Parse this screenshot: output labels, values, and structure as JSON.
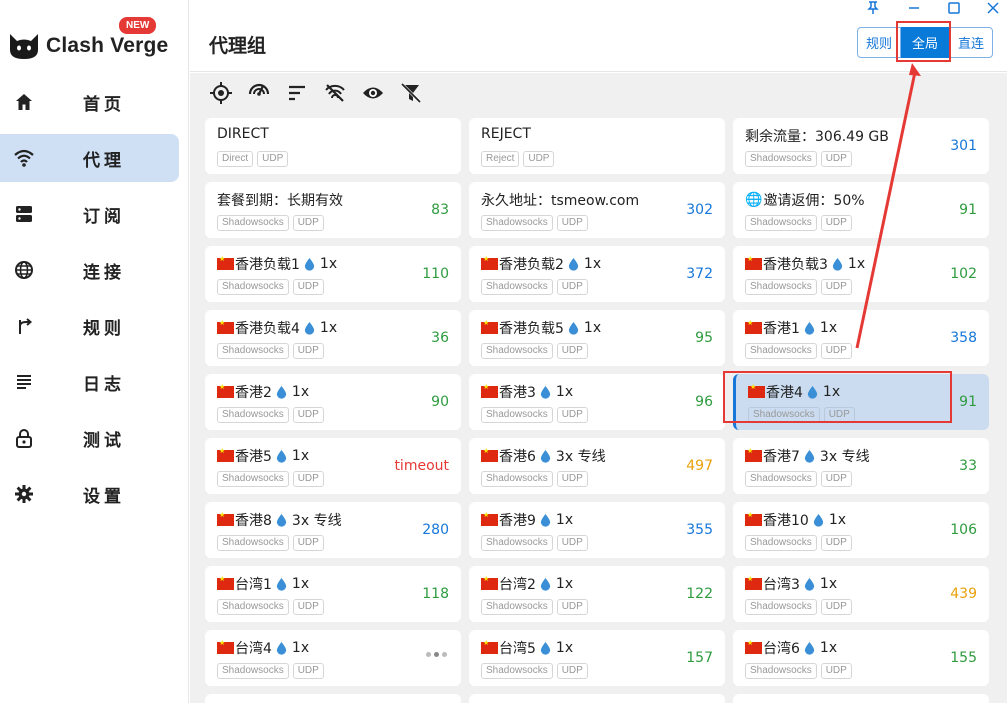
{
  "app": {
    "name": "Clash Verge",
    "badge": "NEW"
  },
  "sidebar": {
    "items": [
      {
        "label": "首页",
        "icon": "home-icon"
      },
      {
        "label": "代理",
        "icon": "wifi-icon",
        "active": true
      },
      {
        "label": "订阅",
        "icon": "server-icon"
      },
      {
        "label": "连接",
        "icon": "globe-icon"
      },
      {
        "label": "规则",
        "icon": "fork-arrow-icon"
      },
      {
        "label": "日志",
        "icon": "list-icon"
      },
      {
        "label": "测试",
        "icon": "lock-icon"
      },
      {
        "label": "设置",
        "icon": "gear-icon"
      }
    ]
  },
  "header": {
    "title": "代理组",
    "modes": [
      {
        "label": "规则",
        "active": false
      },
      {
        "label": "全局",
        "active": true
      },
      {
        "label": "直连",
        "active": false
      }
    ]
  },
  "toolbar": {
    "icons": [
      "locate-icon",
      "speed-test-icon",
      "sort-icon",
      "filter-off-icon",
      "eye-icon",
      "filter-clear-icon"
    ]
  },
  "colors": {
    "accent": "#1677d9",
    "active_nav": "#cfe0f5",
    "selected_card": "#cbdcf0",
    "annotation_red": "#e53935",
    "delay_green": "#2e9b3f",
    "delay_orange": "#e8a10c",
    "delay_blue": "#1677d9"
  },
  "proxies": [
    {
      "name": "DIRECT",
      "tags": [
        "Direct",
        "UDP"
      ],
      "delay": "",
      "color": ""
    },
    {
      "name": "REJECT",
      "tags": [
        "Reject",
        "UDP"
      ],
      "delay": "",
      "color": ""
    },
    {
      "name": "剩余流量：306.49 GB",
      "tags": [
        "Shadowsocks",
        "UDP"
      ],
      "delay": "301",
      "color": "blue"
    },
    {
      "name": "套餐到期：长期有效",
      "tags": [
        "Shadowsocks",
        "UDP"
      ],
      "delay": "83",
      "color": "green"
    },
    {
      "name": "永久地址：tsmeow.com",
      "tags": [
        "Shadowsocks",
        "UDP"
      ],
      "delay": "302",
      "color": "blue"
    },
    {
      "name": "邀请返佣：50%",
      "globe": true,
      "tags": [
        "Shadowsocks",
        "UDP"
      ],
      "delay": "91",
      "color": "green"
    },
    {
      "name": "香港负载1",
      "flag": true,
      "mult": "1x",
      "tags": [
        "Shadowsocks",
        "UDP"
      ],
      "delay": "110",
      "color": "green"
    },
    {
      "name": "香港负载2",
      "flag": true,
      "mult": "1x",
      "tags": [
        "Shadowsocks",
        "UDP"
      ],
      "delay": "372",
      "color": "blue"
    },
    {
      "name": "香港负载3",
      "flag": true,
      "mult": "1x",
      "tags": [
        "Shadowsocks",
        "UDP"
      ],
      "delay": "102",
      "color": "green"
    },
    {
      "name": "香港负载4",
      "flag": true,
      "mult": "1x",
      "tags": [
        "Shadowsocks",
        "UDP"
      ],
      "delay": "36",
      "color": "green"
    },
    {
      "name": "香港负载5",
      "flag": true,
      "mult": "1x",
      "tags": [
        "Shadowsocks",
        "UDP"
      ],
      "delay": "95",
      "color": "green"
    },
    {
      "name": "香港1",
      "flag": true,
      "mult": "1x",
      "tags": [
        "Shadowsocks",
        "UDP"
      ],
      "delay": "358",
      "color": "blue"
    },
    {
      "name": "香港2",
      "flag": true,
      "mult": "1x",
      "tags": [
        "Shadowsocks",
        "UDP"
      ],
      "delay": "90",
      "color": "green"
    },
    {
      "name": "香港3",
      "flag": true,
      "mult": "1x",
      "tags": [
        "Shadowsocks",
        "UDP"
      ],
      "delay": "96",
      "color": "green"
    },
    {
      "name": "香港4",
      "flag": true,
      "mult": "1x",
      "tags": [
        "Shadowsocks",
        "UDP"
      ],
      "delay": "91",
      "color": "green",
      "selected": true
    },
    {
      "name": "香港5",
      "flag": true,
      "mult": "1x",
      "tags": [
        "Shadowsocks",
        "UDP"
      ],
      "delay": "timeout",
      "color": "red"
    },
    {
      "name": "香港6",
      "flag": true,
      "mult": "3x 专线",
      "tags": [
        "Shadowsocks",
        "UDP"
      ],
      "delay": "497",
      "color": "orange"
    },
    {
      "name": "香港7",
      "flag": true,
      "mult": "3x 专线",
      "tags": [
        "Shadowsocks",
        "UDP"
      ],
      "delay": "33",
      "color": "green"
    },
    {
      "name": "香港8",
      "flag": true,
      "mult": "3x 专线",
      "tags": [
        "Shadowsocks",
        "UDP"
      ],
      "delay": "280",
      "color": "blue"
    },
    {
      "name": "香港9",
      "flag": true,
      "mult": "1x",
      "tags": [
        "Shadowsocks",
        "UDP"
      ],
      "delay": "355",
      "color": "blue"
    },
    {
      "name": "香港10",
      "flag": true,
      "mult": "1x",
      "tags": [
        "Shadowsocks",
        "UDP"
      ],
      "delay": "106",
      "color": "green"
    },
    {
      "name": "台湾1",
      "flag": true,
      "mult": "1x",
      "tags": [
        "Shadowsocks",
        "UDP"
      ],
      "delay": "118",
      "color": "green"
    },
    {
      "name": "台湾2",
      "flag": true,
      "mult": "1x",
      "tags": [
        "Shadowsocks",
        "UDP"
      ],
      "delay": "122",
      "color": "green"
    },
    {
      "name": "台湾3",
      "flag": true,
      "mult": "1x",
      "tags": [
        "Shadowsocks",
        "UDP"
      ],
      "delay": "439",
      "color": "orange"
    },
    {
      "name": "台湾4",
      "flag": true,
      "mult": "1x",
      "tags": [
        "Shadowsocks",
        "UDP"
      ],
      "delay": "",
      "color": "",
      "loading": true
    },
    {
      "name": "台湾5",
      "flag": true,
      "mult": "1x",
      "tags": [
        "Shadowsocks",
        "UDP"
      ],
      "delay": "157",
      "color": "green"
    },
    {
      "name": "台湾6",
      "flag": true,
      "mult": "1x",
      "tags": [
        "Shadowsocks",
        "UDP"
      ],
      "delay": "155",
      "color": "green"
    }
  ]
}
